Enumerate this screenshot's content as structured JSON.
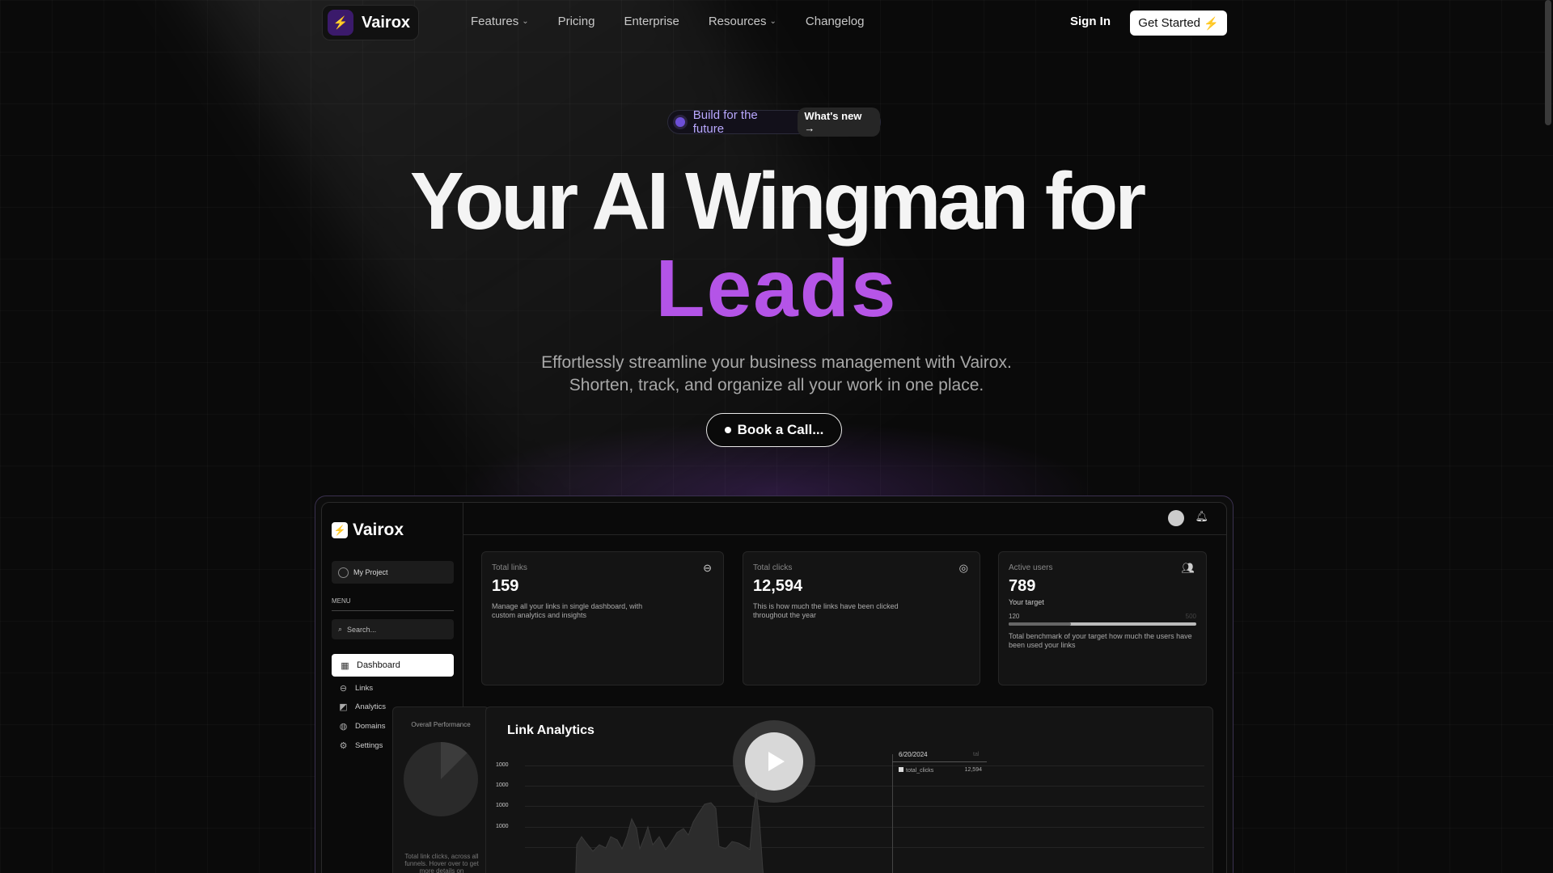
{
  "nav": {
    "brand": "Vairox",
    "links": [
      "Features",
      "Pricing",
      "Enterprise",
      "Resources",
      "Changelog"
    ],
    "sign_in": "Sign In",
    "get_started": "Get Started"
  },
  "hero": {
    "pill_text": "Build for the future",
    "pill_badge": "What's new",
    "title_line1": "Your AI Wingman for",
    "title_line2": "Leads",
    "subtitle_line1": "Effortlessly streamline your business management with Vairox.",
    "subtitle_line2": "Shorten, track, and organize all your work in one place.",
    "cta": "Book a Call..."
  },
  "app": {
    "brand": "Vairox",
    "project": "My Project",
    "menu_label": "MENU",
    "search_placeholder": "Search...",
    "nav": [
      "Dashboard",
      "Links",
      "Analytics",
      "Domains",
      "Settings"
    ],
    "cards": {
      "links": {
        "label": "Total links",
        "value": "159",
        "desc": "Manage all your links in single dashboard, with custom analytics and insights"
      },
      "clicks": {
        "label": "Total clicks",
        "value": "12,594",
        "desc": "This is how much the links have been clicked throughout the year"
      },
      "users": {
        "label": "Active users",
        "value": "789",
        "target_label": "Your target",
        "progress_current": "120",
        "progress_max": "500",
        "progress_fraction": 0.33,
        "desc": "Total benchmark of your target how much the users have been used your links"
      }
    },
    "performance": {
      "label": "Overall Performance",
      "desc": "Total link clicks, across all funnels. Hover over to get more details on"
    },
    "analytics": {
      "title": "Link Analytics",
      "y_ticks": [
        "1000",
        "1000",
        "1000",
        "1000"
      ],
      "tooltip_date": "6/20/2024",
      "tooltip_series": "total_clicks",
      "tooltip_value": "12,594",
      "total_label_fragment": "tal"
    }
  }
}
